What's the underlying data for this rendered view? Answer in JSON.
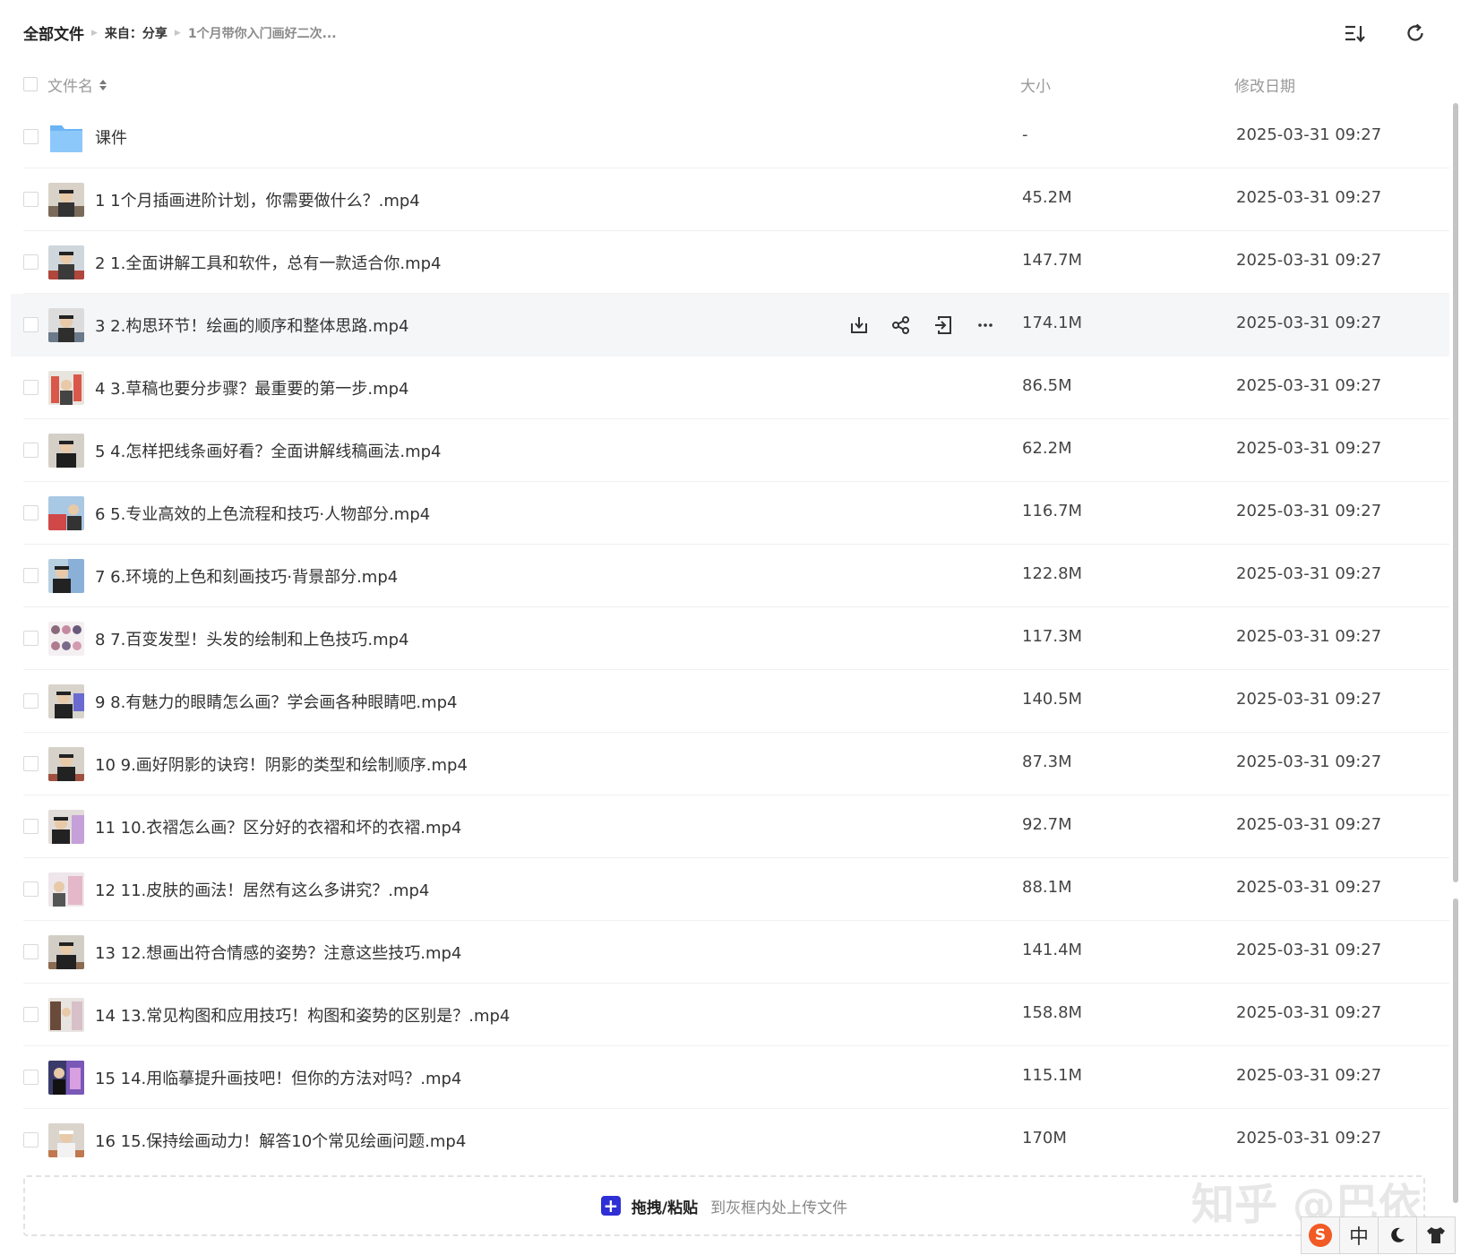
{
  "breadcrumb": {
    "root": "全部文件",
    "source": "来自：分享",
    "current": "1个月带你入门画好二次..."
  },
  "toolbar": {
    "sort_icon": "sort-list-icon",
    "refresh_icon": "refresh-icon"
  },
  "columns": {
    "name": "文件名",
    "size": "大小",
    "date": "修改日期"
  },
  "files": [
    {
      "name": "课件",
      "size": "-",
      "date": "2025-03-31 09:27",
      "type": "folder"
    },
    {
      "name": "1 1个月插画进阶计划，你需要做什么？.mp4",
      "size": "45.2M",
      "date": "2025-03-31 09:27",
      "type": "video"
    },
    {
      "name": "2 1.全面讲解工具和软件，总有一款适合你.mp4",
      "size": "147.7M",
      "date": "2025-03-31 09:27",
      "type": "video"
    },
    {
      "name": "3 2.构思环节！绘画的顺序和整体思路.mp4",
      "size": "174.1M",
      "date": "2025-03-31 09:27",
      "type": "video",
      "hovered": true
    },
    {
      "name": "4 3.草稿也要分步骤？最重要的第一步.mp4",
      "size": "86.5M",
      "date": "2025-03-31 09:27",
      "type": "video"
    },
    {
      "name": "5 4.怎样把线条画好看？全面讲解线稿画法.mp4",
      "size": "62.2M",
      "date": "2025-03-31 09:27",
      "type": "video"
    },
    {
      "name": "6 5.专业高效的上色流程和技巧·人物部分.mp4",
      "size": "116.7M",
      "date": "2025-03-31 09:27",
      "type": "video"
    },
    {
      "name": "7 6.环境的上色和刻画技巧·背景部分.mp4",
      "size": "122.8M",
      "date": "2025-03-31 09:27",
      "type": "video"
    },
    {
      "name": "8 7.百变发型！头发的绘制和上色技巧.mp4",
      "size": "117.3M",
      "date": "2025-03-31 09:27",
      "type": "video"
    },
    {
      "name": "9 8.有魅力的眼睛怎么画？学会画各种眼睛吧.mp4",
      "size": "140.5M",
      "date": "2025-03-31 09:27",
      "type": "video"
    },
    {
      "name": "10 9.画好阴影的诀窍！阴影的类型和绘制顺序.mp4",
      "size": "87.3M",
      "date": "2025-03-31 09:27",
      "type": "video"
    },
    {
      "name": "11 10.衣褶怎么画？区分好的衣褶和坏的衣褶.mp4",
      "size": "92.7M",
      "date": "2025-03-31 09:27",
      "type": "video"
    },
    {
      "name": "12 11.皮肤的画法！居然有这么多讲究？.mp4",
      "size": "88.1M",
      "date": "2025-03-31 09:27",
      "type": "video"
    },
    {
      "name": "13 12.想画出符合情感的姿势？注意这些技巧.mp4",
      "size": "141.4M",
      "date": "2025-03-31 09:27",
      "type": "video"
    },
    {
      "name": "14 13.常见构图和应用技巧！构图和姿势的区别是？.mp4",
      "size": "158.8M",
      "date": "2025-03-31 09:27",
      "type": "video"
    },
    {
      "name": "15 14.用临摹提升画技吧！但你的方法对吗？.mp4",
      "size": "115.1M",
      "date": "2025-03-31 09:27",
      "type": "video"
    },
    {
      "name": "16 15.保持绘画动力！解答10个常见绘画问题.mp4",
      "size": "170M",
      "date": "2025-03-31 09:27",
      "type": "video"
    }
  ],
  "row_actions": [
    "download-icon",
    "share-icon",
    "save-to-icon",
    "more-icon"
  ],
  "upload": {
    "main": "拖拽/粘贴",
    "sub": "到灰框内处上传文件"
  },
  "watermark": "知乎 @巴依",
  "ime": {
    "logo": "S",
    "lang": "中",
    "icons": [
      "sogou-logo-icon",
      "moon-icon",
      "shirt-icon"
    ]
  },
  "colors": {
    "accent": "#2f2fd6",
    "folder": "#5aa8f0",
    "hover_row": "#f5f6f8"
  }
}
